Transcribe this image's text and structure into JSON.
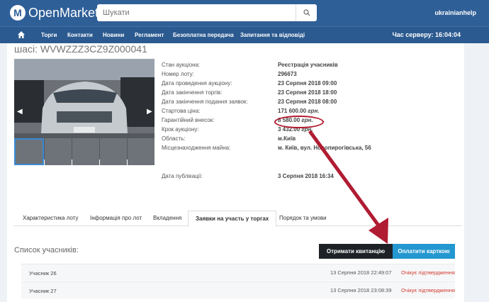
{
  "header": {
    "logo_text": "OpenMarket",
    "search_placeholder": "Шукати",
    "user": "ukrainianhelp"
  },
  "nav": {
    "items": [
      "Торги",
      "Контакти",
      "Новини",
      "Регламент",
      "Безоплатна передача",
      "Запитання та відповіді"
    ],
    "server_time": "Час серверу: 16:04:04"
  },
  "lot": {
    "title": "шасі: WVWZZZ3CZ9Z000041",
    "info": [
      {
        "label": "Стан аукціона:",
        "value": "Реєстрація учасників"
      },
      {
        "label": "Номер лоту:",
        "value": "296673"
      },
      {
        "label": "Дата проведення аукціону:",
        "value": "23 Серпня 2018 09:00"
      },
      {
        "label": "Дата закінчення торгів:",
        "value": "23 Серпня 2018 18:00"
      },
      {
        "label": "Дата закінчення подання заявок:",
        "value": "23 Серпня 2018 08:00"
      },
      {
        "label": "Стартова ціна:",
        "value": "171 600.00",
        "unit": "грн."
      },
      {
        "label": "Гарантійний внесок:",
        "value": "8 580.00",
        "unit": "грн."
      },
      {
        "label": "Крок аукціону:",
        "value": "3 432.00",
        "unit": "грн."
      },
      {
        "label": "Область:",
        "value": "м.Київ"
      },
      {
        "label": "Місцезнаходження майна:",
        "value": "м. Київ, вул. Новопирогівська, 56"
      },
      {
        "label": "Дата публікації:",
        "value": "3 Серпня 2018 16:34"
      }
    ]
  },
  "tabs": [
    "Характеристика лоту",
    "Інформація про лот",
    "Вкладення",
    "Заявки на участь у торгах",
    "Порядок та умови"
  ],
  "participants": {
    "title": "Список учасників:",
    "receipt_button": "Отримати квитанцію",
    "pay_button": "Оплатити карткою",
    "rows": [
      {
        "name": "Учасник 26",
        "date": "13 Серпня 2018 22:49:07",
        "status": "Очікує підтвердження"
      },
      {
        "name": "Учасник 27",
        "date": "13 Серпня 2018 23:08:39",
        "status": "Очікує підтвердження"
      }
    ]
  },
  "colors": {
    "brand": "#2f5f97",
    "accent": "#2397d0",
    "highlight": "#b31a2e"
  }
}
